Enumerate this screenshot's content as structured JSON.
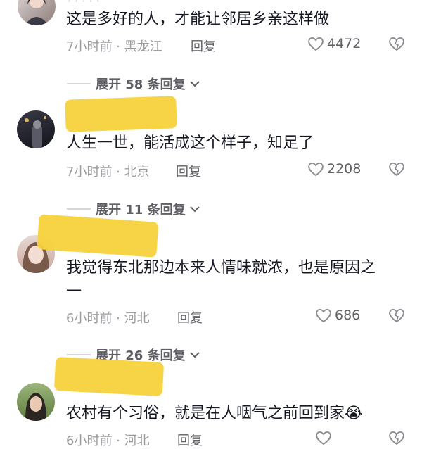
{
  "comments": [
    {
      "text": "这是多好的人，才能让邻居乡亲这样做",
      "time_location": "7小时前 · 黑龙江",
      "reply_label": "回复",
      "likes": "4472",
      "expand_label": "展开 58 条回复"
    },
    {
      "text": "人生一世，能活成这个样子，知足了",
      "time_location": "7小时前 · 北京",
      "reply_label": "回复",
      "likes": "2208",
      "expand_label": "展开 11 条回复"
    },
    {
      "text_line1": "我觉得东北那边本来人情味就浓，也是原因之",
      "text_line2": "一",
      "time_location": "6小时前 · 河北",
      "reply_label": "回复",
      "likes": "686",
      "expand_label": "展开 26 条回复"
    },
    {
      "text": "农村有个习俗，就是在人咽气之前回到家",
      "emoji": "😭",
      "time_location": "6小时前 · 河北",
      "reply_label": "回复"
    }
  ],
  "colors": {
    "redaction": "#f7d23c",
    "text": "#161823",
    "meta": "#9b9b9f"
  }
}
